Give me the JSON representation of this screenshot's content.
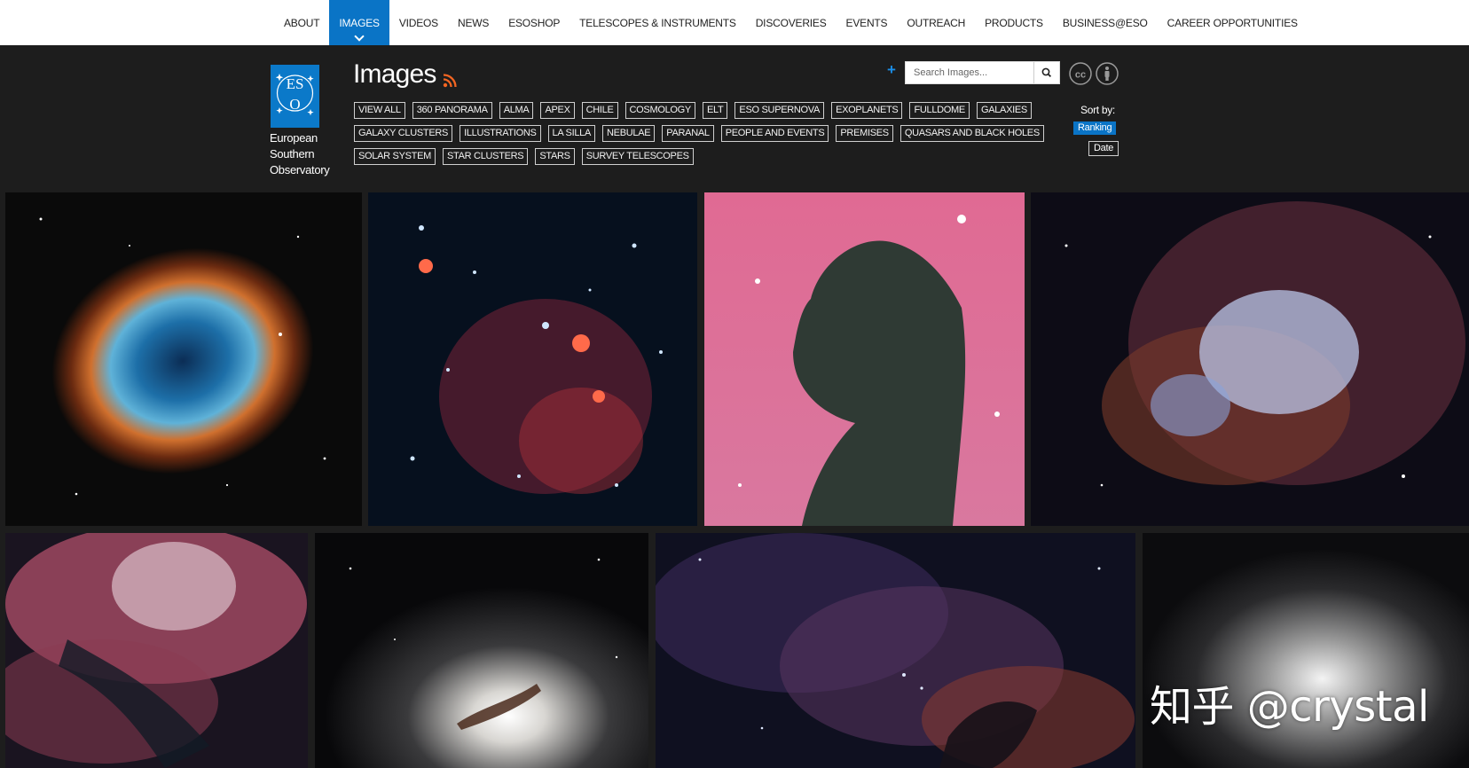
{
  "nav": {
    "items": [
      {
        "label": "ABOUT"
      },
      {
        "label": "IMAGES",
        "active": true
      },
      {
        "label": "VIDEOS"
      },
      {
        "label": "NEWS"
      },
      {
        "label": "ESOSHOP"
      },
      {
        "label": "TELESCOPES & INSTRUMENTS"
      },
      {
        "label": "DISCOVERIES"
      },
      {
        "label": "EVENTS"
      },
      {
        "label": "OUTREACH"
      },
      {
        "label": "PRODUCTS"
      },
      {
        "label": "BUSINESS@ESO"
      },
      {
        "label": "CAREER OPPORTUNITIES"
      }
    ]
  },
  "logo": {
    "lines": [
      "European",
      "Southern",
      "Observatory"
    ],
    "mark": "ESO"
  },
  "page": {
    "title": "Images"
  },
  "search": {
    "placeholder": "Search Images..."
  },
  "tags": [
    [
      "VIEW ALL",
      "360 PANORAMA",
      "ALMA",
      "APEX",
      "CHILE",
      "COSMOLOGY",
      "ELT",
      "ESO SUPERNOVA",
      "EXOPLANETS",
      "FULLDOME",
      "GALAXIES"
    ],
    [
      "GALAXY CLUSTERS",
      "ILLUSTRATIONS",
      "LA SILLA",
      "NEBULAE",
      "PARANAL",
      "PEOPLE AND EVENTS",
      "PREMISES",
      "QUASARS AND BLACK HOLES"
    ],
    [
      "SOLAR SYSTEM",
      "STAR CLUSTERS",
      "STARS",
      "SURVEY TELESCOPES"
    ]
  ],
  "sort": {
    "label": "Sort by:",
    "options": [
      "Ranking",
      "Date"
    ],
    "selected": "Ranking"
  },
  "watermark": "知乎 @crystal",
  "colors": {
    "accent": "#0a74c6",
    "background": "#1d1d1d",
    "rss": "#f26522"
  },
  "icons": [
    "rss-icon",
    "plus-icon",
    "search-icon",
    "cc-icon",
    "attribution-icon"
  ]
}
